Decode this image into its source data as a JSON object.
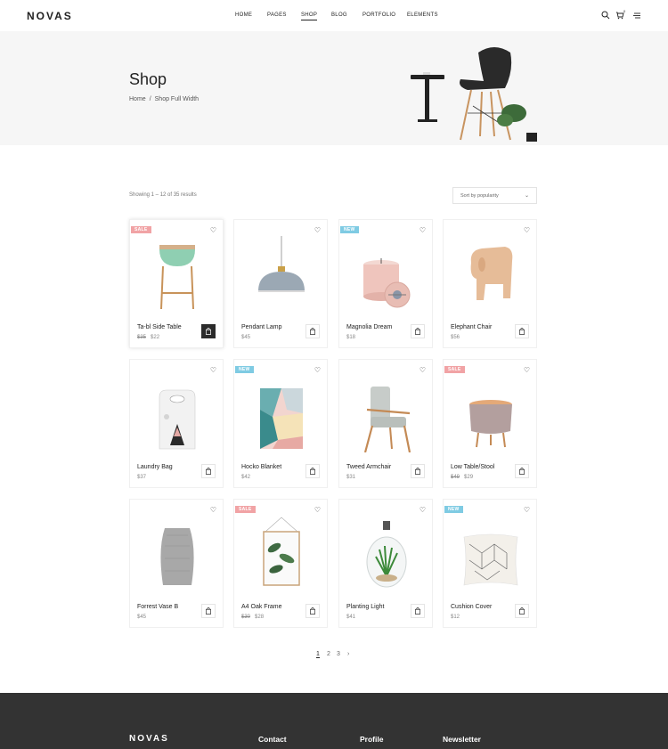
{
  "header": {
    "logo": "NOVAS",
    "nav": [
      {
        "label": "HOME",
        "active": false
      },
      {
        "label": "PAGES",
        "active": false
      },
      {
        "label": "SHOP",
        "active": true
      },
      {
        "label": "BLOG",
        "active": false
      },
      {
        "label": "PORTFOLIO",
        "active": false
      },
      {
        "label": "ELEMENTS",
        "active": false
      }
    ],
    "cart_count": "0",
    "icons": [
      "search-icon",
      "cart-icon",
      "menu-icon"
    ]
  },
  "hero": {
    "title": "Shop",
    "breadcrumb": {
      "home": "Home",
      "sep": "/",
      "current": "Shop Full Width"
    }
  },
  "toolbar": {
    "results": "Showing 1 – 12 of 35 results",
    "sort": "Sort by popularity"
  },
  "products": [
    {
      "name": "Ta-bl Side Table",
      "old_price": "$35",
      "price": "$22",
      "badge": "SALE"
    },
    {
      "name": "Pendant Lamp",
      "old_price": "",
      "price": "$45",
      "badge": ""
    },
    {
      "name": "Magnolia Dream",
      "old_price": "",
      "price": "$18",
      "badge": "NEW"
    },
    {
      "name": "Elephant Chair",
      "old_price": "",
      "price": "$56",
      "badge": ""
    },
    {
      "name": "Laundry Bag",
      "old_price": "",
      "price": "$37",
      "badge": ""
    },
    {
      "name": "Hocko Blanket",
      "old_price": "",
      "price": "$42",
      "badge": "NEW"
    },
    {
      "name": "Tweed Armchair",
      "old_price": "",
      "price": "$31",
      "badge": ""
    },
    {
      "name": "Low Table/Stool",
      "old_price": "$49",
      "price": "$29",
      "badge": "SALE"
    },
    {
      "name": "Forrest Vase B",
      "old_price": "",
      "price": "$45",
      "badge": ""
    },
    {
      "name": "A4 Oak Frame",
      "old_price": "$30",
      "price": "$28",
      "badge": "SALE"
    },
    {
      "name": "Planting Light",
      "old_price": "",
      "price": "$41",
      "badge": ""
    },
    {
      "name": "Cushion Cover",
      "old_price": "",
      "price": "$12",
      "badge": "NEW"
    }
  ],
  "pagination": [
    "1",
    "2",
    "3",
    "›"
  ],
  "footer": {
    "logo": "NOVAS",
    "columns": [
      "Contact",
      "Profile",
      "Newsletter"
    ]
  },
  "colors": {
    "sale": "#f1a3a5",
    "new": "#7fcbe3",
    "footer": "#333333",
    "hero": "#f6f6f6"
  }
}
